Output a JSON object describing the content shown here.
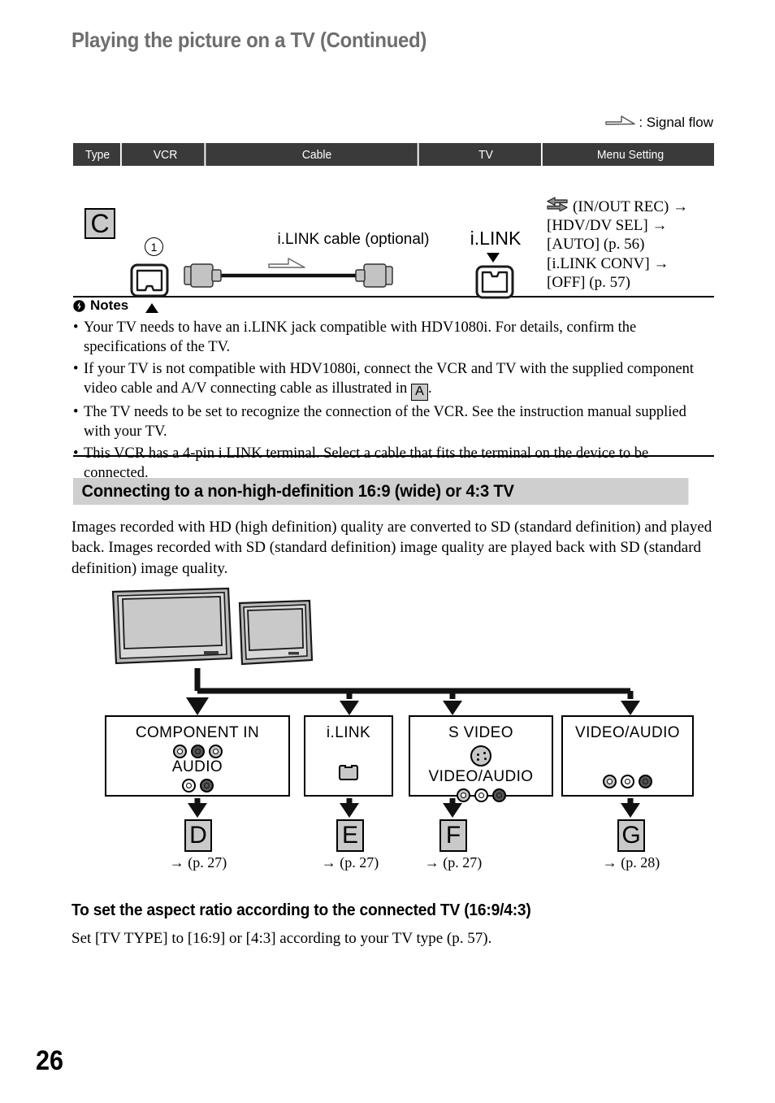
{
  "page": {
    "title": "Playing the picture on a TV (Continued)",
    "number": "26"
  },
  "legend": {
    "icon": "signal-flow-arrow-icon",
    "text": ": Signal flow"
  },
  "table": {
    "headers": [
      "Type",
      "VCR",
      "Cable",
      "TV",
      "Menu Setting"
    ],
    "row": {
      "type_badge": "C",
      "vcr_jack_number": "1",
      "vcr_jack_icon": "ilink-jack-icon",
      "cable_label": "i.LINK cable (optional)",
      "cable_icon": "ilink-cable-icon",
      "tv_label": "i.LINK",
      "tv_jack_icon": "ilink-jack-icon",
      "menu_setting": [
        "(IN/OUT REC) →",
        "[HDV/DV SEL] →",
        "[AUTO] (p. 56)",
        "[i.LINK CONV] →",
        "[OFF] (p. 57)"
      ]
    }
  },
  "notes": {
    "heading": "Notes",
    "heading_icon": "note-alert-icon",
    "items": [
      "Your TV needs to have an i.LINK jack compatible with HDV1080i. For details, confirm the specifications of the TV.",
      "If your TV is not compatible with HDV1080i, connect the VCR and TV with the supplied component video cable and A/V connecting cable as illustrated in ",
      "The TV needs to be set to recognize the connection of the VCR. See the instruction manual supplied with your TV.",
      "This VCR has a 4-pin i.LINK terminal. Select a cable that fits the terminal on the device to be connected."
    ],
    "item2_badge": "A",
    "item2_tail": "."
  },
  "section": {
    "heading": "Connecting to a non-high-definition 16:9 (wide) or 4:3 TV",
    "paragraph": "Images recorded with HD (high definition) quality are converted to SD (standard definition) and played back. Images recorded with SD (standard definition) image quality are played back with SD (standard definition) image quality."
  },
  "diagram": {
    "tv_icon_large": "widescreen-tv-icon",
    "tv_icon_small": "standard-tv-icon",
    "jack_boxes": [
      {
        "label": "COMPONENT IN",
        "label2": "AUDIO",
        "jacks_top": [
          "rca-jack-grey",
          "rca-jack-dark",
          "rca-jack-grey"
        ],
        "jacks_bottom": [
          "rca-jack-white",
          "rca-jack-dark"
        ]
      },
      {
        "label": "i.LINK",
        "label2": "",
        "jacks_top": [
          "ilink-port-icon"
        ],
        "jacks_bottom": []
      },
      {
        "label": "S VIDEO",
        "label2": "VIDEO/AUDIO",
        "jacks_top": [
          "s-video-jack-icon"
        ],
        "jacks_bottom": [
          "rca-jack-grey",
          "rca-jack-white",
          "rca-jack-dark"
        ]
      },
      {
        "label": "VIDEO/AUDIO",
        "label2": "",
        "jacks_top": [],
        "jacks_bottom": [
          "rca-jack-grey",
          "rca-jack-white",
          "rca-jack-dark"
        ]
      }
    ],
    "letters": [
      {
        "badge": "D",
        "page_ref": "→ (p. 27)"
      },
      {
        "badge": "E",
        "page_ref": "→ (p. 27)"
      },
      {
        "badge": "F",
        "page_ref": "→ (p. 27)"
      },
      {
        "badge": "G",
        "page_ref": "→ (p. 28)"
      }
    ]
  },
  "aspect": {
    "heading": "To set the aspect ratio according to the connected TV (16:9/4:3)",
    "paragraph": "Set [TV TYPE] to [16:9] or [4:3] according to your TV type (p. 57)."
  },
  "colors": {
    "header_bg": "#3a3a3a",
    "title_grey": "#6e6e6e",
    "section_bg": "#cfcfcf",
    "badge_bg": "#c9c9c9"
  }
}
